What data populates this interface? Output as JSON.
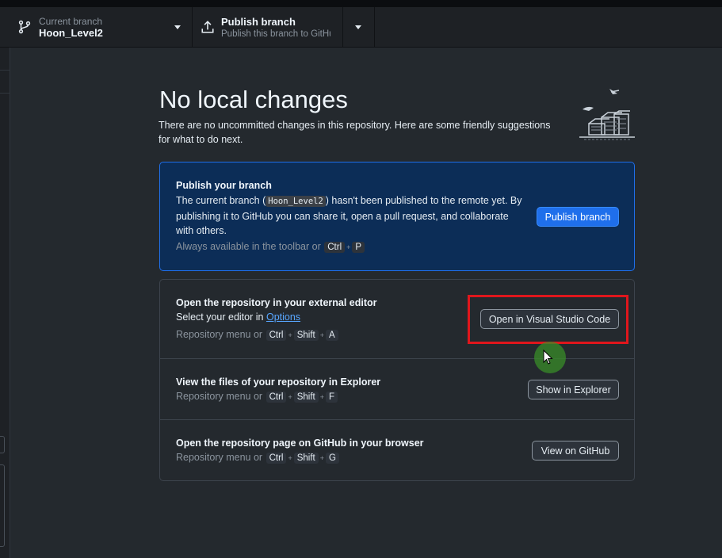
{
  "toolbar": {
    "current_branch_title": "Current branch",
    "current_branch_value": "Hoon_Level2",
    "publish_title": "Publish branch",
    "publish_sub": "Publish this branch to GitHub"
  },
  "main": {
    "heading": "No local changes",
    "description": "There are no uncommitted changes in this repository. Here are some friendly suggestions for what to do next."
  },
  "publish_card": {
    "title": "Publish your branch",
    "text_before": "The current branch (",
    "branch_code": "Hoon_Level2",
    "text_after": ") hasn't been published to the remote yet. By publishing it to GitHub you can share it, open a pull request, and collaborate with others.",
    "hint": "Always available in the toolbar or",
    "keys": [
      "Ctrl",
      "P"
    ],
    "button": "Publish branch"
  },
  "suggestions": [
    {
      "title": "Open the repository in your external editor",
      "sub_text": "Select your editor in",
      "sub_link": "Options",
      "hint": "Repository menu or",
      "keys": [
        "Ctrl",
        "Shift",
        "A"
      ],
      "button": "Open in Visual Studio Code"
    },
    {
      "title": "View the files of your repository in Explorer",
      "hint": "Repository menu or",
      "keys": [
        "Ctrl",
        "Shift",
        "F"
      ],
      "button": "Show in Explorer"
    },
    {
      "title": "Open the repository page on GitHub in your browser",
      "hint": "Repository menu or",
      "keys": [
        "Ctrl",
        "Shift",
        "G"
      ],
      "button": "View on GitHub"
    }
  ],
  "colors": {
    "background": "#24292e",
    "publish_card_bg": "#0c2d57",
    "primary_button": "#1f6feb",
    "link": "#58a6ff",
    "highlight_box": "#e0161c",
    "cursor_halo": "#388c28"
  },
  "icons": {
    "branch": "git-branch-icon",
    "publish": "upload-icon",
    "illustration": "folder-stack-illustration"
  }
}
